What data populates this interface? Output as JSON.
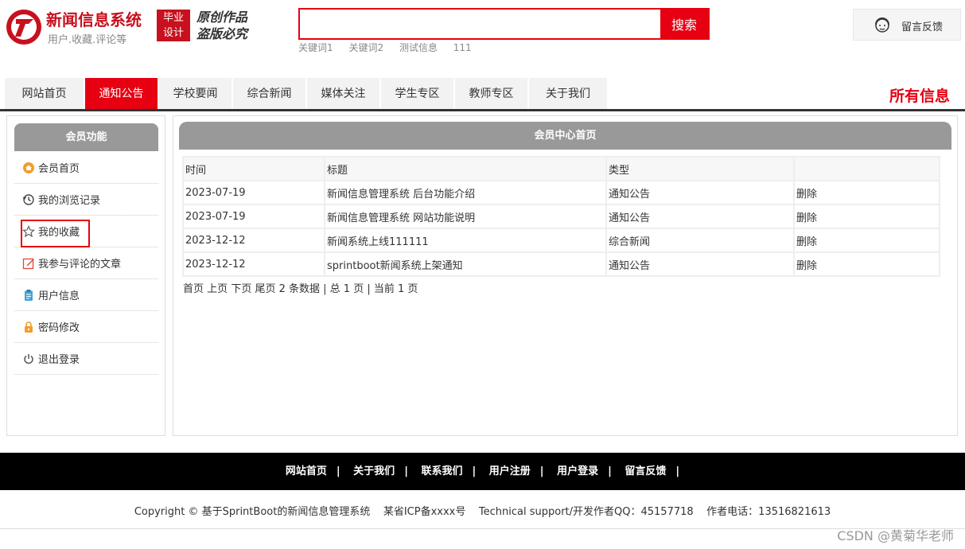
{
  "header": {
    "site_title": "新闻信息系统",
    "site_subtitle": "用户.收藏.评论等",
    "badge_line1": "毕业",
    "badge_line2": "设计",
    "slogan_line1": "原创作品",
    "slogan_line2": "盗版必究",
    "search": {
      "value": "",
      "placeholder": "",
      "button_label": "搜索"
    },
    "keywords": [
      "关键词1",
      "关键词2",
      "测试信息",
      "111"
    ],
    "feedback_label": "留言反馈"
  },
  "nav": {
    "items": [
      {
        "label": "网站首页",
        "active": false
      },
      {
        "label": "通知公告",
        "active": true
      },
      {
        "label": "学校要闻",
        "active": false
      },
      {
        "label": "综合新闻",
        "active": false
      },
      {
        "label": "媒体关注",
        "active": false
      },
      {
        "label": "学生专区",
        "active": false
      },
      {
        "label": "教师专区",
        "active": false
      },
      {
        "label": "关于我们",
        "active": false
      }
    ],
    "right_label": "所有信息"
  },
  "sidebar": {
    "title": "会员功能",
    "items": [
      {
        "label": "会员首页",
        "icon": "home-icon"
      },
      {
        "label": "我的浏览记录",
        "icon": "history-icon"
      },
      {
        "label": "我的收藏",
        "icon": "star-icon",
        "highlighted": true
      },
      {
        "label": "我参与评论的文章",
        "icon": "edit-icon"
      },
      {
        "label": "用户信息",
        "icon": "clipboard-icon"
      },
      {
        "label": "密码修改",
        "icon": "lock-icon"
      },
      {
        "label": "退出登录",
        "icon": "power-icon"
      }
    ]
  },
  "main": {
    "title": "会员中心首页",
    "columns": [
      "时间",
      "标题",
      "类型",
      ""
    ],
    "rows": [
      {
        "time": "2023-07-19",
        "title": "新闻信息管理系统 后台功能介绍",
        "type": "通知公告",
        "action": "删除"
      },
      {
        "time": "2023-07-19",
        "title": "新闻信息管理系统 网站功能说明",
        "type": "通知公告",
        "action": "删除"
      },
      {
        "time": "2023-12-12",
        "title": "新闻系统上线111111",
        "type": "综合新闻",
        "action": "删除"
      },
      {
        "time": "2023-12-12",
        "title": "sprintboot新闻系统上架通知",
        "type": "通知公告",
        "action": "删除"
      }
    ],
    "pager": {
      "first": "首页",
      "prev": "上页",
      "next": "下页",
      "last": "尾页",
      "summary": "2 条数据 | 总 1 页 | 当前 1 页"
    }
  },
  "footer": {
    "links": [
      "网站首页",
      "关于我们",
      "联系我们",
      "用户注册",
      "用户登录",
      "留言反馈"
    ],
    "separator": "|",
    "copyright": "Copyright © 基于SprintBoot的新闻信息管理系统    某省ICP备xxxx号    Technical support/开发作者QQ：45157718    作者电话：13516821613"
  },
  "watermark": "CSDN @黄菊华老师",
  "colors": {
    "accent": "#e60012",
    "header_gray": "#999999",
    "footer": "#000000"
  }
}
